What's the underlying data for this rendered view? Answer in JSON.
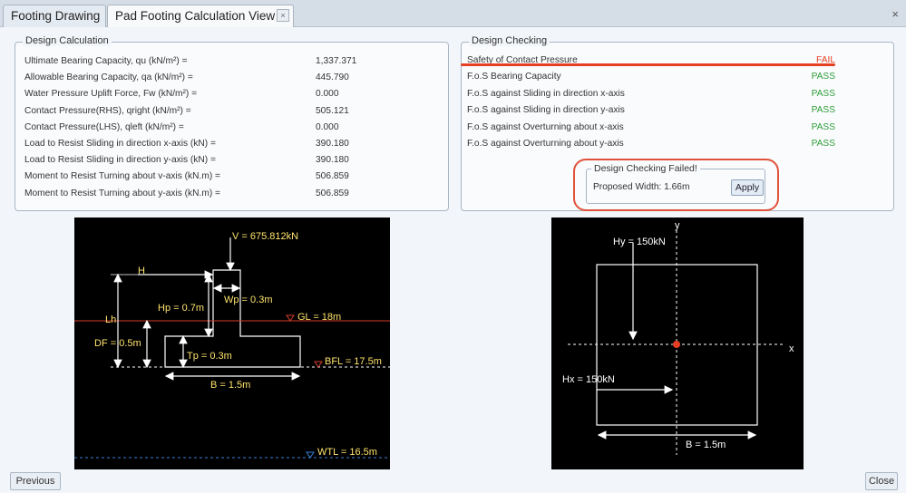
{
  "tabs": [
    {
      "label": "Footing Drawing"
    },
    {
      "label": "Pad Footing Calculation View"
    }
  ],
  "tab_close_glyph": "×",
  "window_close_glyph": "×",
  "design_calculation": {
    "title": "Design Calculation",
    "rows": [
      {
        "label": "Ultimate Bearing Capacity, qu (kN/m²) =",
        "value": "1,337.371"
      },
      {
        "label": "Allowable Bearing Capacity, qa (kN/m²) =",
        "value": "445.790"
      },
      {
        "label": "Water Pressure Uplift Force, Fw (kN/m²) =",
        "value": "0.000"
      },
      {
        "label": "Contact Pressure(RHS), qright (kN/m²) =",
        "value": "505.121"
      },
      {
        "label": "Contact Pressure(LHS), qleft (kN/m²) =",
        "value": "0.000"
      },
      {
        "label": "Load to Resist Sliding in direction x-axis (kN) =",
        "value": "390.180"
      },
      {
        "label": "Load to Resist Sliding in direction y-axis (kN) =",
        "value": "390.180"
      },
      {
        "label": "Moment to Resist Turning about v-axis (kN.m) =",
        "value": "506.859"
      },
      {
        "label": "Moment to Resist Turning about y-axis (kN.m) =",
        "value": "506.859"
      }
    ]
  },
  "design_checking": {
    "title": "Design Checking",
    "rows": [
      {
        "label": "Safety of Contact Pressure",
        "status": "FAIL"
      },
      {
        "label": "F.o.S Bearing Capacity",
        "status": "PASS"
      },
      {
        "label": "F.o.S against Sliding in direction x-axis",
        "status": "PASS"
      },
      {
        "label": "F.o.S against Sliding in direction y-axis",
        "status": "PASS"
      },
      {
        "label": "F.o.S against Overturning about x-axis",
        "status": "PASS"
      },
      {
        "label": "F.o.S against Overturning about y-axis",
        "status": "PASS"
      }
    ],
    "failed_group_title": "Design Checking Failed!",
    "proposed_text": "Proposed Width: 1.66m",
    "apply_label": "Apply"
  },
  "section_drawing": {
    "v_label": "V = 675.812kN",
    "h_label": "H",
    "hp_label": "Hp = 0.7m",
    "wp_label": "Wp = 0.3m",
    "lh_label": "Lh",
    "gl_label": "GL = 18m",
    "df_label": "DF = 0.5m",
    "tp_label": "Tp = 0.3m",
    "bfl_label": "BFL = 17.5m",
    "b_label": "B = 1.5m",
    "wtl_label": "WTL = 16.5m"
  },
  "plan_drawing": {
    "y_axis_label": "y",
    "x_axis_label": "x",
    "hy_label": "Hy = 150kN",
    "hx_label": "Hx = 150kN",
    "b_label": "B = 1.5m"
  },
  "footer": {
    "previous_label": "Previous",
    "close_label": "Close"
  },
  "colors": {
    "pass": "#2e9e3a",
    "fail": "#e53e22",
    "annotation": "#ffe36b"
  }
}
